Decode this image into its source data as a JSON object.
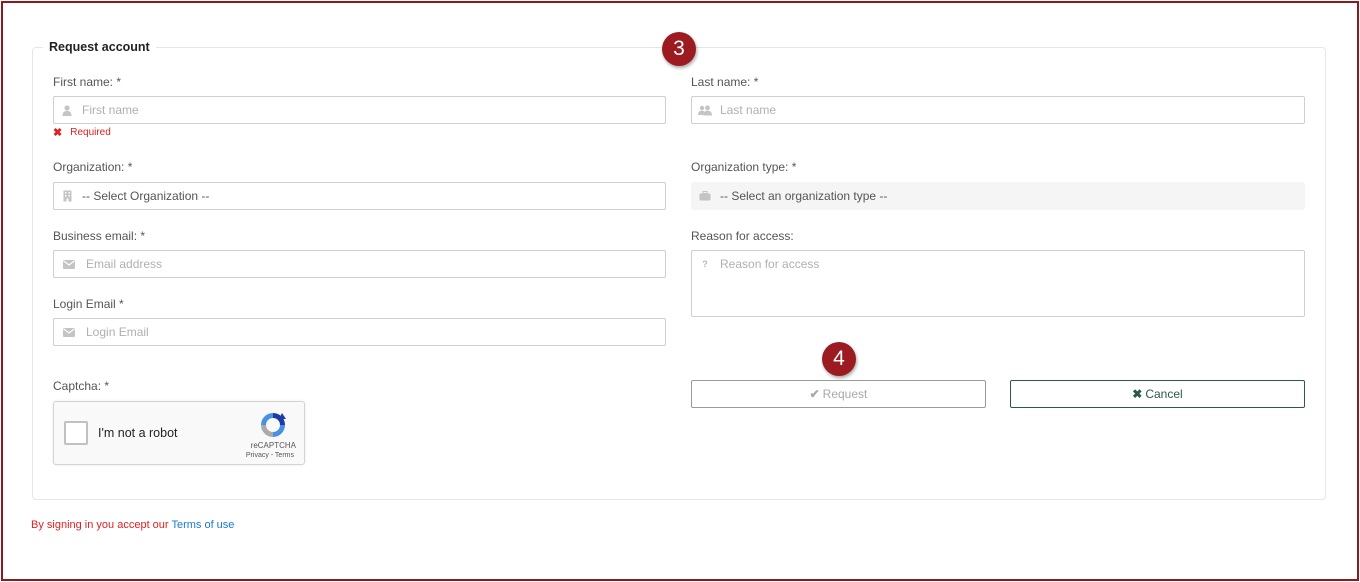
{
  "panel": {
    "title": "Request account"
  },
  "form": {
    "first_name": {
      "label": "First name: *",
      "placeholder": "First name",
      "error": "Required"
    },
    "last_name": {
      "label": "Last name: *",
      "placeholder": "Last name"
    },
    "organization": {
      "label": "Organization: *",
      "selected": "-- Select Organization --"
    },
    "organization_type": {
      "label": "Organization type: *",
      "selected": "-- Select an organization type --"
    },
    "business_email": {
      "label": "Business email: *",
      "placeholder": "Email address"
    },
    "reason": {
      "label": "Reason for access:",
      "placeholder": "Reason for access"
    },
    "login_email": {
      "label": "Login Email *",
      "placeholder": "Login Email"
    },
    "captcha": {
      "label": "Captcha: *",
      "checkbox_text": "I'm not a robot",
      "brand": "reCAPTCHA",
      "links": "Privacy - Terms"
    }
  },
  "buttons": {
    "request": "Request",
    "cancel": "Cancel"
  },
  "badges": {
    "step_3": "3",
    "step_4": "4"
  },
  "footer": {
    "text": "By signing in you accept our ",
    "link": "Terms of use"
  },
  "colors": {
    "error": "#e02020",
    "link": "#1a7ad4",
    "cancel": "#2c5a4a",
    "badge": "#9b1b21",
    "frame": "#8b1a1e"
  }
}
